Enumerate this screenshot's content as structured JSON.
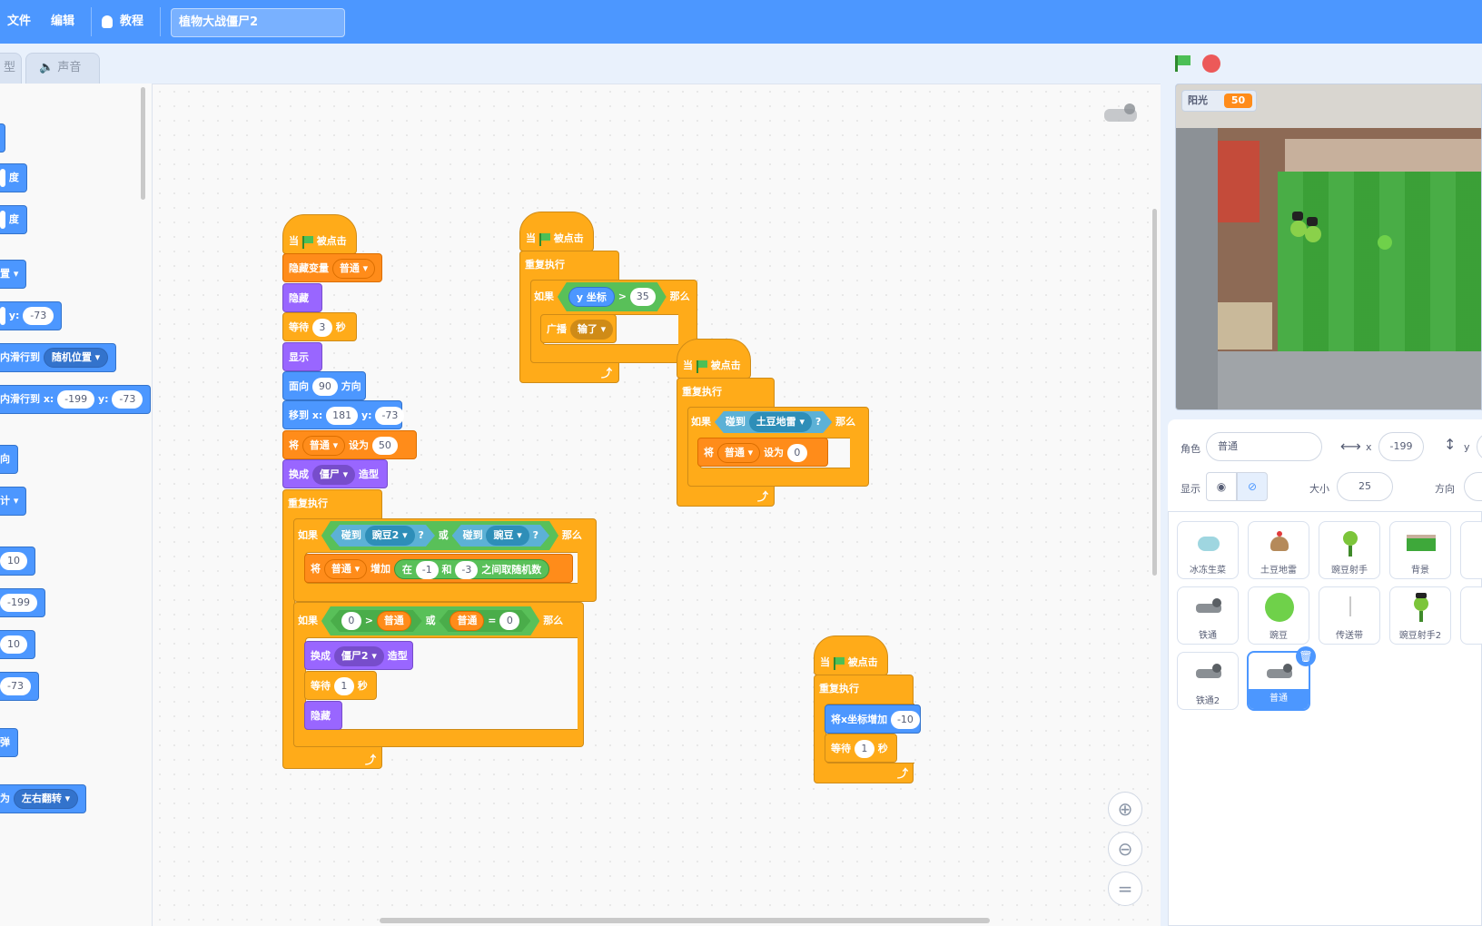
{
  "menubar": {
    "file": "文件",
    "edit": "编辑",
    "tutorials": "教程",
    "project_title": "植物大战僵尸2"
  },
  "tabs": {
    "costumes_partial": "型",
    "sounds": "声音"
  },
  "palette": {
    "b1_unit": "度",
    "b2_unit": "度",
    "b3_dd": "置",
    "b4_y_label": "y:",
    "b4_y": "-73",
    "b5_text": "内滑行到",
    "b5_dd": "随机位置",
    "b6_text": "内滑行到 x:",
    "b6_x": "-199",
    "b6_y_label": "y:",
    "b6_y": "-73",
    "b7_text": "向",
    "b8_dd": "计",
    "b9_val": "10",
    "b10_val": "-199",
    "b11_val": "10",
    "b12_val": "-73",
    "b13_text": "弹",
    "b14_text": "为",
    "b14_dd": "左右翻转"
  },
  "script1": {
    "hat_when": "当",
    "hat_clicked": "被点击",
    "hide_var": "隐藏变量",
    "hide_var_dd": "普通",
    "hide": "隐藏",
    "wait": "等待",
    "wait_val": "3",
    "sec": "秒",
    "show": "显示",
    "point": "面向",
    "point_val": "90",
    "direction": "方向",
    "goto": "移到 x:",
    "goto_x": "181",
    "goto_y_label": "y:",
    "goto_y": "-73",
    "set": "将",
    "set_dd": "普通",
    "set_to": "设为",
    "set_val": "50",
    "switch": "换成",
    "switch_dd": "僵尸",
    "costume": "造型",
    "forever": "重复执行",
    "if1": "如果",
    "touch": "碰到",
    "touch_dd1": "豌豆2",
    "q": "?",
    "or": "或",
    "touch_dd2": "豌豆",
    "then": "那么",
    "change_set": "将",
    "change_dd": "普通",
    "change_by": "增加",
    "rand_in": "在",
    "rand_a": "-1",
    "rand_and": "和",
    "rand_b": "-3",
    "rand_pick": "之间取随机数",
    "if2": "如果",
    "cmp_a": "0",
    "gt": ">",
    "cmp_var1": "普通",
    "or2": "或",
    "cmp_var2": "普通",
    "eq": "=",
    "cmp_b": "0",
    "then2": "那么",
    "switch2": "换成",
    "switch2_dd": "僵尸2",
    "costume2": "造型",
    "wait2": "等待",
    "wait2_val": "1",
    "sec2": "秒",
    "hide2": "隐藏"
  },
  "script2": {
    "hat_when": "当",
    "hat_clicked": "被点击",
    "forever": "重复执行",
    "if": "如果",
    "ypos": "y 坐标",
    "gt": ">",
    "val": "35",
    "then": "那么",
    "broadcast": "广播",
    "broadcast_dd": "输了"
  },
  "script3": {
    "hat_when": "当",
    "hat_clicked": "被点击",
    "forever": "重复执行",
    "if": "如果",
    "touch": "碰到",
    "touch_dd": "土豆地雷",
    "q": "?",
    "then": "那么",
    "set": "将",
    "set_dd": "普通",
    "set_to": "设为",
    "set_val": "0"
  },
  "script4": {
    "hat_when": "当",
    "hat_clicked": "被点击",
    "forever": "重复执行",
    "change_x": "将x坐标增加",
    "change_x_val": "-10",
    "wait": "等待",
    "wait_val": "1",
    "sec": "秒"
  },
  "stage": {
    "monitor_label": "阳光",
    "monitor_value": "50",
    "flag_color": "#4cbf56",
    "stop_color": "#ec5959"
  },
  "sprite_info": {
    "sprite_label": "角色",
    "sprite_name": "普通",
    "x_label": "x",
    "x_val": "-199",
    "y_label": "y",
    "show_label": "显示",
    "size_label": "大小",
    "size_val": "25",
    "direction_label": "方向"
  },
  "sprites": [
    {
      "name": "冰冻生菜"
    },
    {
      "name": "土豆地雷"
    },
    {
      "name": "豌豆射手"
    },
    {
      "name": "背景"
    },
    {
      "name": "铁通"
    },
    {
      "name": "豌豆"
    },
    {
      "name": "传送带"
    },
    {
      "name": "豌豆射手2"
    },
    {
      "name": "铁通2"
    },
    {
      "name": "普通"
    }
  ],
  "zoom": {
    "in": "+",
    "out": "−",
    "reset": "="
  }
}
